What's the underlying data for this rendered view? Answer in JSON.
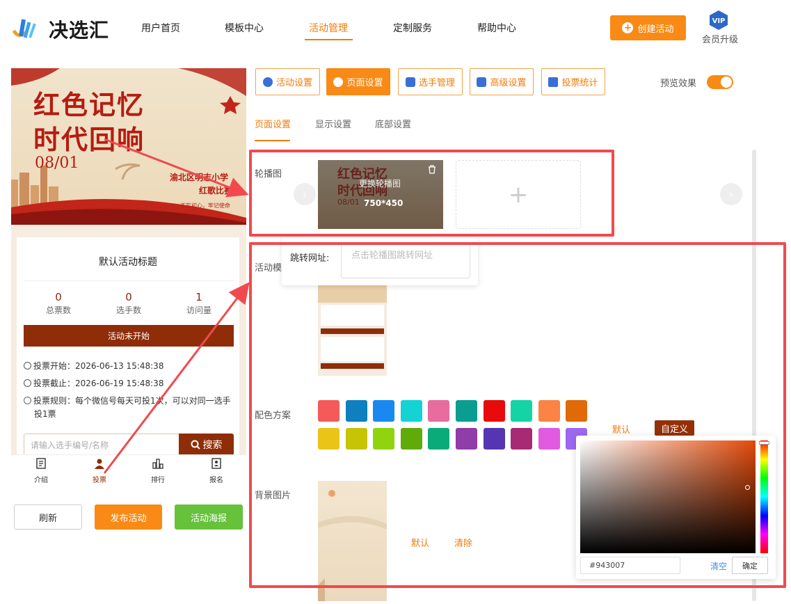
{
  "brand": {
    "name": "决选汇"
  },
  "nav": {
    "items": [
      "用户首页",
      "模板中心",
      "活动管理",
      "定制服务",
      "帮助中心"
    ],
    "active": "活动管理",
    "create_label": "创建活动",
    "vip_badge": "VIP",
    "vip_label": "会员升级"
  },
  "preview": {
    "banner": {
      "line1": "红色记忆",
      "line2": "时代回响",
      "date": "08/01",
      "school_line1": "渝北区明志小学",
      "school_line2": "红歌比赛",
      "slogan": "不忘初心，牢记使命"
    },
    "title": "默认活动标题",
    "stats": [
      {
        "value": "0",
        "label": "总票数"
      },
      {
        "value": "0",
        "label": "选手数"
      },
      {
        "value": "1",
        "label": "访问量"
      }
    ],
    "status": "活动未开始",
    "vote_start": "投票开始：2026-06-13 15:48:38",
    "vote_end": "投票截止：2026-06-19 15:48:38",
    "vote_rule": "投票规则：每个微信号每天可投1次，可以对同一选手投1票",
    "search_placeholder": "请输入选手编号/名称",
    "search_label": "搜索",
    "tabbar": [
      "介绍",
      "投票",
      "排行",
      "报名"
    ],
    "buttons": {
      "refresh": "刷新",
      "publish": "发布活动",
      "poster": "活动海报"
    }
  },
  "settings": {
    "tabs": [
      "活动设置",
      "页面设置",
      "选手管理",
      "高级设置",
      "投票统计"
    ],
    "active_tab": "页面设置",
    "preview_toggle_label": "预览效果",
    "preview_toggle_on": true,
    "subtabs": [
      "页面设置",
      "显示设置",
      "底部设置"
    ],
    "active_subtab": "页面设置",
    "carousel": {
      "label": "轮播图",
      "replace_label": "更换轮播图",
      "size_label": "750*450",
      "url_label": "跳转网址:",
      "url_placeholder": "点击轮播图跳转网址"
    },
    "template_label": "活动模板",
    "color_scheme": {
      "label": "配色方案",
      "swatches": [
        "#f55a5a",
        "#0e7fbf",
        "#1989f0",
        "#13d3d4",
        "#e86c9d",
        "#0a9e91",
        "#e80b0b",
        "#14d4a6",
        "#fb8344",
        "#e06a06",
        "#eac417",
        "#c7c305",
        "#8fd40f",
        "#5fab0a",
        "#0aab79",
        "#8f3da8",
        "#5635b3",
        "#a62a74",
        "#e25ae0",
        "#9d68f0"
      ],
      "default_label": "默认",
      "custom_label": "自定义",
      "selected_color": "#943007"
    },
    "color_picker": {
      "hex_value": "#943007",
      "clear_label": "清空",
      "ok_label": "确定"
    },
    "background": {
      "label": "背景图片",
      "default_label": "默认",
      "clear_label": "清除"
    }
  }
}
